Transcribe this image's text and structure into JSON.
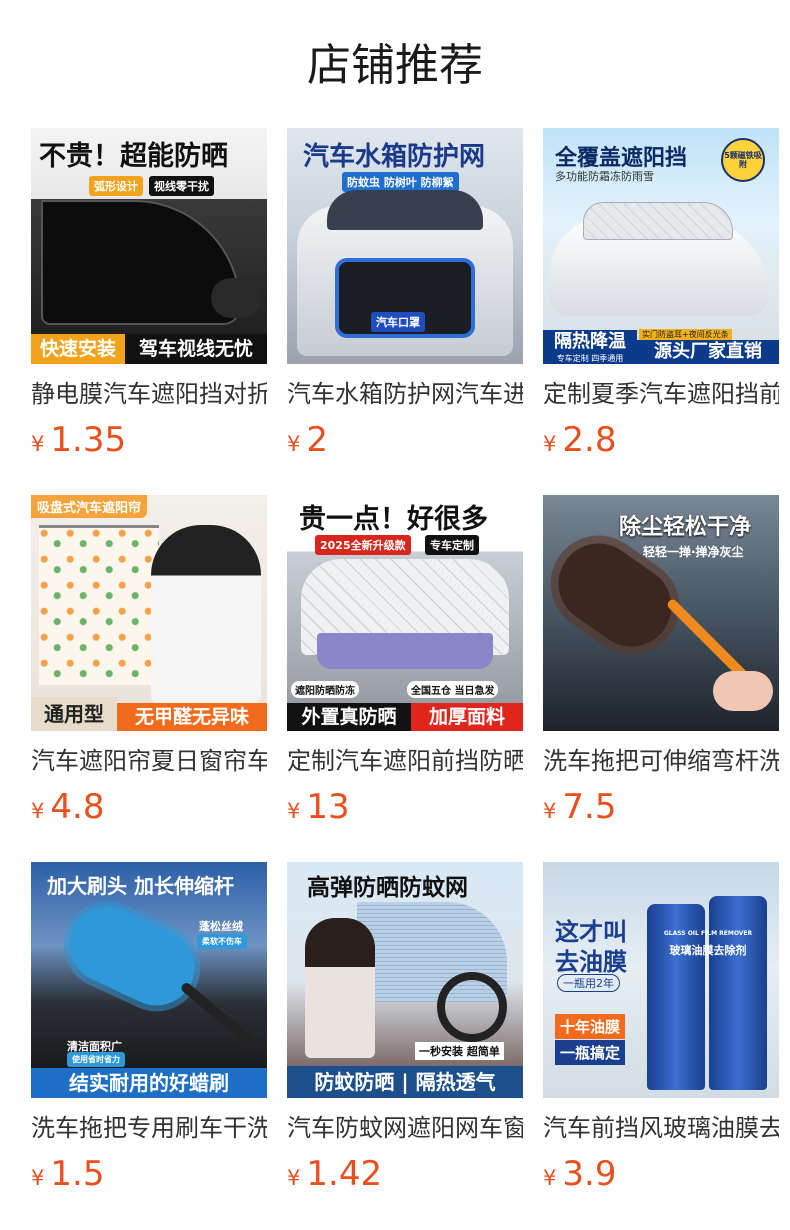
{
  "header": {
    "title": "店铺推荐"
  },
  "currency": "¥",
  "products": [
    {
      "name": "静电膜汽车遮阳挡对折",
      "price": "1.35",
      "img": {
        "headline": "不贵！超能防晒",
        "tag1": "弧形设计",
        "tag2": "视线零干扰",
        "bottom_left": "快速安装",
        "bottom_right": "驾车视线无忧"
      }
    },
    {
      "name": "汽车水箱防护网汽车进",
      "price": "2",
      "img": {
        "headline": "汽车水箱防护网",
        "tag1": "防蚊虫 防树叶 防柳絮",
        "plate": "汽车口罩"
      }
    },
    {
      "name": "定制夏季汽车遮阳挡前",
      "price": "2.8",
      "img": {
        "headline": "全覆盖遮阳挡",
        "sub": "多功能防霜冻防雨雪",
        "badge": "5颗磁铁吸附",
        "bottom_left": "隔热降温",
        "bottom_left_sub": "专车定制 四季通用",
        "bottom_mid": "实门防盗耳+夜间反光条",
        "bottom_right": "源头厂家直销"
      }
    },
    {
      "name": "汽车遮阳帘夏日窗帘车",
      "price": "4.8",
      "img": {
        "headline": "吸盘式汽车遮阳帘",
        "bottom_left": "通用型",
        "bottom_right": "无甲醛无异味"
      }
    },
    {
      "name": "定制汽车遮阳前挡防晒",
      "price": "13",
      "img": {
        "headline": "贵一点！好很多",
        "tag1": "2025全新升级款",
        "tag2": "专车定制",
        "feat1": "遮阳防晒防冻",
        "feat2": "全国五仓 当日急发",
        "bottom_left": "外置真防晒",
        "bottom_right": "加厚面料"
      }
    },
    {
      "name": "洗车拖把可伸缩弯杆洗",
      "price": "7.5",
      "img": {
        "headline": "除尘轻松干净",
        "sub": "轻轻一掸·掸净灰尘"
      }
    },
    {
      "name": "洗车拖把专用刷车干洗",
      "price": "1.5",
      "img": {
        "headline": "加大刷头 加长伸缩杆",
        "tag1": "蓬松丝绒",
        "tag1_sub": "柔软不伤车",
        "tag2": "清洁面积广",
        "tag2_sub": "使用省时省力",
        "bottom": "结实耐用的好蜡刷"
      }
    },
    {
      "name": "汽车防蚊网遮阳网车窗",
      "price": "1.42",
      "img": {
        "headline": "高弹防晒防蚊网",
        "tag1": "一秒安装 超简单",
        "bottom": "防蚊防晒 | 隔热透气"
      }
    },
    {
      "name": "汽车前挡风玻璃油膜去除",
      "price": "3.9",
      "img": {
        "headline1": "这才叫",
        "headline2": "去油膜",
        "sub": "一瓶用2年",
        "tag1": "十年油膜",
        "tag2": "一瓶搞定",
        "can_text": "玻璃油膜去除剂",
        "can_brand": "GLASS OIL FILM REMOVER"
      }
    }
  ],
  "colors": {
    "price": "#e8501e",
    "title": "#1a1a1a",
    "name": "#333333"
  }
}
